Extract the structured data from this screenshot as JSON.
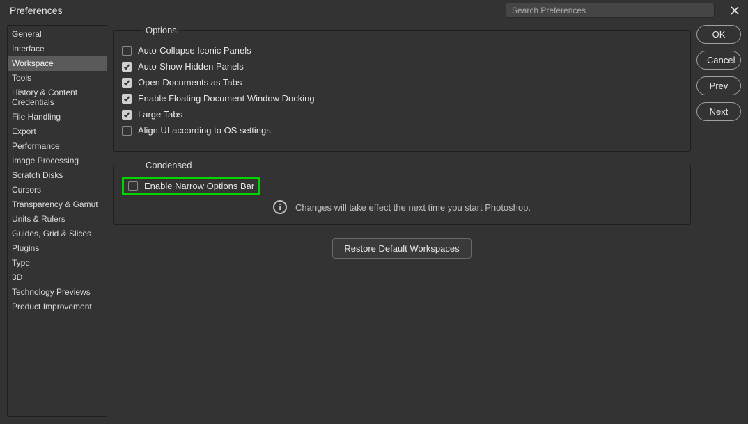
{
  "window": {
    "title": "Preferences",
    "search_placeholder": "Search Preferences"
  },
  "sidebar": {
    "items": [
      {
        "label": "General"
      },
      {
        "label": "Interface"
      },
      {
        "label": "Workspace",
        "selected": true
      },
      {
        "label": "Tools"
      },
      {
        "label": "History & Content Credentials"
      },
      {
        "label": "File Handling"
      },
      {
        "label": "Export"
      },
      {
        "label": "Performance"
      },
      {
        "label": "Image Processing"
      },
      {
        "label": "Scratch Disks"
      },
      {
        "label": "Cursors"
      },
      {
        "label": "Transparency & Gamut"
      },
      {
        "label": "Units & Rulers"
      },
      {
        "label": "Guides, Grid & Slices"
      },
      {
        "label": "Plugins"
      },
      {
        "label": "Type"
      },
      {
        "label": "3D"
      },
      {
        "label": "Technology Previews"
      },
      {
        "label": "Product Improvement"
      }
    ]
  },
  "options_group": {
    "legend": "Options",
    "checks": [
      {
        "label": "Auto-Collapse Iconic Panels",
        "checked": false
      },
      {
        "label": "Auto-Show Hidden Panels",
        "checked": true
      },
      {
        "label": "Open Documents as Tabs",
        "checked": true
      },
      {
        "label": "Enable Floating Document Window Docking",
        "checked": true
      },
      {
        "label": "Large Tabs",
        "checked": true
      },
      {
        "label": "Align UI according to OS settings",
        "checked": false
      }
    ]
  },
  "condensed_group": {
    "legend": "Condensed",
    "check": {
      "label": "Enable Narrow Options Bar",
      "checked": false
    },
    "info_text": "Changes will take effect the next time you start Photoshop."
  },
  "buttons": {
    "restore": "Restore Default Workspaces",
    "ok": "OK",
    "cancel": "Cancel",
    "prev": "Prev",
    "next": "Next"
  }
}
